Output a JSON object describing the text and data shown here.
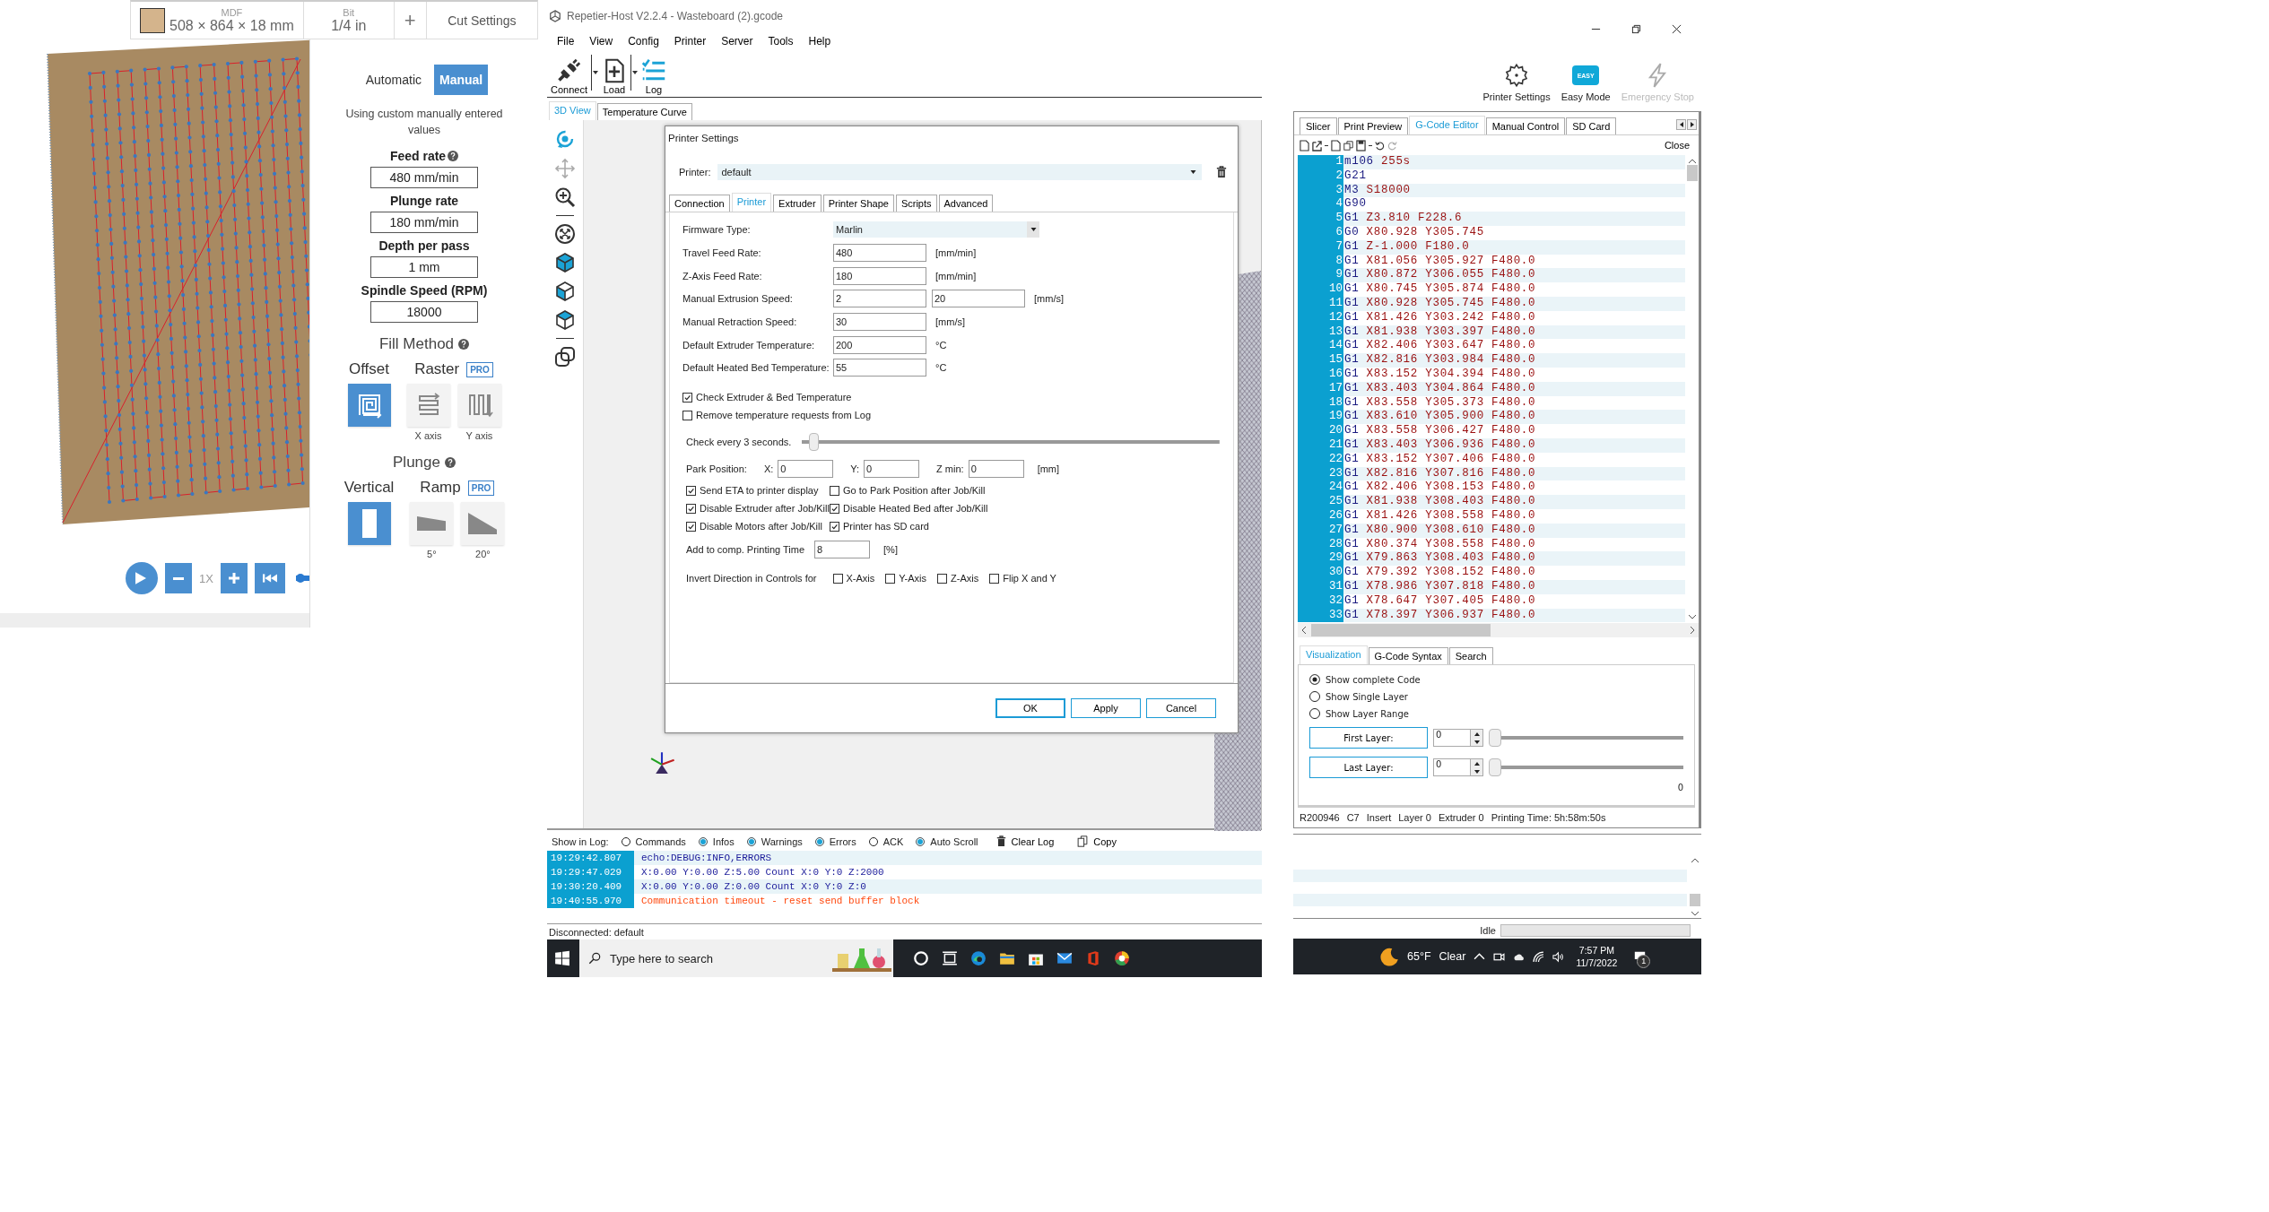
{
  "left_app": {
    "material": {
      "label": "MDF",
      "size": "508 × 864 × 18 mm"
    },
    "bit": {
      "label": "Bit",
      "value": "1/4 in"
    },
    "add_button": "+",
    "cut_settings": "Cut Settings",
    "modes": [
      {
        "label": "Automatic",
        "selected": false
      },
      {
        "label": "Manual",
        "selected": true
      }
    ],
    "mode_note": "Using custom manually entered values",
    "fields": [
      {
        "label": "Feed rate",
        "help": true,
        "value": "480 mm/min"
      },
      {
        "label": "Plunge rate",
        "help": false,
        "value": "180 mm/min"
      },
      {
        "label": "Depth per pass",
        "help": false,
        "value": "1 mm"
      },
      {
        "label": "Spindle Speed (RPM)",
        "help": false,
        "value": "18000"
      }
    ],
    "fill_method": {
      "title": "Fill Method",
      "groups": [
        {
          "label": "Offset",
          "options": [
            {
              "kind": "spiral",
              "selected": true
            }
          ]
        },
        {
          "label": "Raster",
          "badge": "PRO",
          "options": [
            {
              "kind": "x-raster",
              "caption": "X axis",
              "selected": false
            },
            {
              "kind": "y-raster",
              "caption": "Y axis",
              "selected": false
            }
          ]
        }
      ]
    },
    "plunge": {
      "title": "Plunge",
      "groups": [
        {
          "label": "Vertical",
          "options": [
            {
              "kind": "vertical",
              "selected": true
            }
          ]
        },
        {
          "label": "Ramp",
          "badge": "PRO",
          "options": [
            {
              "kind": "ramp-low",
              "caption": "5°",
              "selected": false
            },
            {
              "kind": "ramp-high",
              "caption": "20°",
              "selected": false
            }
          ]
        }
      ]
    },
    "speed": "1X",
    "scrubber": {
      "level": 0
    }
  },
  "repetier": {
    "title": "Repetier-Host V2.2.4 - Wasteboard (2).gcode",
    "menu": [
      "File",
      "View",
      "Config",
      "Printer",
      "Server",
      "Tools",
      "Help"
    ],
    "toolbar": [
      {
        "kind": "connect",
        "label": "Connect",
        "dropdown": true
      },
      {
        "kind": "load",
        "label": "Load",
        "dropdown": true
      },
      {
        "kind": "log",
        "label": "Log",
        "dropdown": false
      }
    ],
    "view_tabs": [
      {
        "label": "3D View",
        "selected": true
      },
      {
        "label": "Temperature Curve",
        "selected": false
      }
    ],
    "dialog": {
      "title": "Printer Settings",
      "printer_label": "Printer:",
      "printer_value": "default",
      "tabs": [
        {
          "label": "Connection",
          "selected": false
        },
        {
          "label": "Printer",
          "selected": true
        },
        {
          "label": "Extruder",
          "selected": false
        },
        {
          "label": "Printer Shape",
          "selected": false
        },
        {
          "label": "Scripts",
          "selected": false
        },
        {
          "label": "Advanced",
          "selected": false
        }
      ],
      "firmware": {
        "label": "Firmware Type:",
        "value": "Marlin"
      },
      "rows": [
        {
          "label": "Travel Feed Rate:",
          "values": [
            "480"
          ],
          "unit": "[mm/min]"
        },
        {
          "label": "Z-Axis Feed Rate:",
          "values": [
            "180"
          ],
          "unit": "[mm/min]"
        },
        {
          "label": "Manual Extrusion Speed:",
          "values": [
            "2",
            "20"
          ],
          "unit": "[mm/s]"
        },
        {
          "label": "Manual Retraction Speed:",
          "values": [
            "30"
          ],
          "unit": "[mm/s]"
        },
        {
          "label": "Default Extruder Temperature:",
          "values": [
            "200"
          ],
          "unit": "°C"
        },
        {
          "label": "Default Heated Bed Temperature:",
          "values": [
            "55"
          ],
          "unit": "°C"
        }
      ],
      "checks": [
        {
          "label": "Check Extruder & Bed Temperature",
          "checked": true
        },
        {
          "label": "Remove temperature requests from Log",
          "checked": false
        }
      ],
      "interval": {
        "label": "Check every 3 seconds.",
        "level": 0.02
      },
      "park": {
        "label": "Park Position:",
        "fields": [
          {
            "label": "X:",
            "value": "0"
          },
          {
            "label": "Y:",
            "value": "0"
          },
          {
            "label": "Z min:",
            "value": "0"
          }
        ],
        "unit": "[mm]"
      },
      "options": [
        {
          "label": "Send ETA to printer display",
          "checked": true
        },
        {
          "label": "Go to Park Position after Job/Kill",
          "checked": false
        },
        {
          "label": "Disable Extruder after Job/Kill",
          "checked": true
        },
        {
          "label": "Disable Heated Bed after Job/Kill",
          "checked": true
        },
        {
          "label": "Disable Motors after Job/Kill",
          "checked": true
        },
        {
          "label": "Printer has SD card",
          "checked": true
        }
      ],
      "comp_time": {
        "label": "Add to comp. Printing Time",
        "value": "8",
        "unit": "[%]"
      },
      "invert": {
        "label": "Invert Direction in Controls for",
        "axes": [
          {
            "label": "X-Axis",
            "checked": false
          },
          {
            "label": "Y-Axis",
            "checked": false
          },
          {
            "label": "Z-Axis",
            "checked": false
          },
          {
            "label": "Flip X and Y",
            "checked": false
          }
        ]
      },
      "buttons": [
        "OK",
        "Apply",
        "Cancel"
      ]
    },
    "log": {
      "label": "Show in Log:",
      "filters": [
        {
          "label": "Commands",
          "checked": false
        },
        {
          "label": "Infos",
          "checked": true
        },
        {
          "label": "Warnings",
          "checked": true
        },
        {
          "label": "Errors",
          "checked": true
        },
        {
          "label": "ACK",
          "checked": false
        },
        {
          "label": "Auto Scroll",
          "checked": true
        }
      ],
      "actions": [
        {
          "kind": "trash",
          "label": "Clear Log"
        },
        {
          "kind": "copy",
          "label": "Copy"
        }
      ],
      "entries": [
        {
          "time": "19:29:42.807",
          "message": "echo:DEBUG:INFO,ERRORS",
          "kind": "info"
        },
        {
          "time": "19:29:47.029",
          "message": "X:0.00 Y:0.00 Z:5.00 Count X:0 Y:0 Z:2000",
          "kind": "info"
        },
        {
          "time": "19:30:20.409",
          "message": "X:0.00 Y:0.00 Z:0.00 Count X:0 Y:0 Z:0",
          "kind": "info"
        },
        {
          "time": "19:40:55.970",
          "message": "Communication timeout - reset send buffer block",
          "kind": "error"
        }
      ]
    },
    "status": "Disconnected: default",
    "taskbar": {
      "search_placeholder": "Type here to search"
    }
  },
  "right_app": {
    "toolbar": [
      {
        "kind": "gear",
        "label": "Printer Settings",
        "disabled": false
      },
      {
        "kind": "easy",
        "label": "Easy Mode",
        "badge": "EASY",
        "disabled": false
      },
      {
        "kind": "bolt",
        "label": "Emergency Stop",
        "disabled": true
      }
    ],
    "tabs": [
      {
        "label": "Slicer",
        "selected": false
      },
      {
        "label": "Print Preview",
        "selected": false
      },
      {
        "label": "G-Code Editor",
        "selected": true
      },
      {
        "label": "Manual Control",
        "selected": false
      },
      {
        "label": "SD Card",
        "selected": false
      }
    ],
    "close": "Close",
    "gcode": [
      {
        "n": "1",
        "code": "m106 255s"
      },
      {
        "n": "2",
        "code": "G21"
      },
      {
        "n": "3",
        "code": "M3 S18000"
      },
      {
        "n": "4",
        "code": "G90"
      },
      {
        "n": "5",
        "code": "G1 Z3.810 F228.6"
      },
      {
        "n": "6",
        "code": "G0 X80.928 Y305.745"
      },
      {
        "n": "7",
        "code": "G1 Z-1.000 F180.0"
      },
      {
        "n": "8",
        "code": "G1 X81.056 Y305.927 F480.0"
      },
      {
        "n": "9",
        "code": "G1 X80.872 Y306.055 F480.0"
      },
      {
        "n": "10",
        "code": "G1 X80.745 Y305.874 F480.0"
      },
      {
        "n": "11",
        "code": "G1 X80.928 Y305.745 F480.0"
      },
      {
        "n": "12",
        "code": "G1 X81.426 Y303.242 F480.0"
      },
      {
        "n": "13",
        "code": "G1 X81.938 Y303.397 F480.0"
      },
      {
        "n": "14",
        "code": "G1 X82.406 Y303.647 F480.0"
      },
      {
        "n": "15",
        "code": "G1 X82.816 Y303.984 F480.0"
      },
      {
        "n": "16",
        "code": "G1 X83.152 Y304.394 F480.0"
      },
      {
        "n": "17",
        "code": "G1 X83.403 Y304.864 F480.0"
      },
      {
        "n": "18",
        "code": "G1 X83.558 Y305.373 F480.0"
      },
      {
        "n": "19",
        "code": "G1 X83.610 Y305.900 F480.0"
      },
      {
        "n": "20",
        "code": "G1 X83.558 Y306.427 F480.0"
      },
      {
        "n": "21",
        "code": "G1 X83.403 Y306.936 F480.0"
      },
      {
        "n": "22",
        "code": "G1 X83.152 Y307.406 F480.0"
      },
      {
        "n": "23",
        "code": "G1 X82.816 Y307.816 F480.0"
      },
      {
        "n": "24",
        "code": "G1 X82.406 Y308.153 F480.0"
      },
      {
        "n": "25",
        "code": "G1 X81.938 Y308.403 F480.0"
      },
      {
        "n": "26",
        "code": "G1 X81.426 Y308.558 F480.0"
      },
      {
        "n": "27",
        "code": "G1 X80.900 Y308.610 F480.0"
      },
      {
        "n": "28",
        "code": "G1 X80.374 Y308.558 F480.0"
      },
      {
        "n": "29",
        "code": "G1 X79.863 Y308.403 F480.0"
      },
      {
        "n": "30",
        "code": "G1 X79.392 Y308.152 F480.0"
      },
      {
        "n": "31",
        "code": "G1 X78.986 Y307.818 F480.0"
      },
      {
        "n": "32",
        "code": "G1 X78.647 Y307.405 F480.0"
      },
      {
        "n": "33",
        "code": "G1 X78.397 Y306.937 F480.0"
      }
    ],
    "lower_tabs": [
      {
        "label": "Visualization",
        "selected": true
      },
      {
        "label": "G-Code Syntax",
        "selected": false
      },
      {
        "label": "Search",
        "selected": false
      }
    ],
    "radios": [
      {
        "label": "Show complete Code",
        "selected": true
      },
      {
        "label": "Show Single Layer",
        "selected": false
      },
      {
        "label": "Show Layer Range",
        "selected": false
      }
    ],
    "layers": [
      {
        "label": "First Layer:",
        "value": "0",
        "level": 0
      },
      {
        "label": "Last Layer:",
        "value": "0",
        "level": 0
      }
    ],
    "layer_count": "0",
    "status": [
      "R200946",
      "C7",
      "Insert",
      "Layer 0",
      "Extruder 0",
      "Printing Time: 5h:58m:50s"
    ],
    "progress": {
      "label": "Idle",
      "level": 0
    },
    "taskbar": {
      "temperature": "65°F",
      "condition": "Clear",
      "time": "7:57 PM",
      "date": "11/7/2022",
      "notifications": "1"
    }
  }
}
